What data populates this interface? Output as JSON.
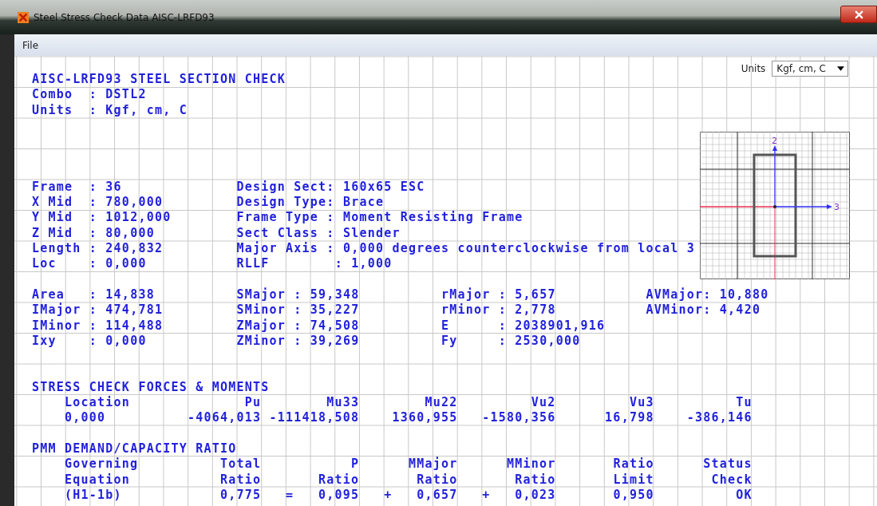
{
  "window": {
    "title": "Steel Stress Check Data  AISC-LRFD93"
  },
  "menu": [
    {
      "label": "File"
    }
  ],
  "units_selector": {
    "label": "Units",
    "value": "Kgf, cm, C"
  },
  "report": {
    "heading": "AISC-LRFD93 STEEL SECTION CHECK",
    "header_lines": [
      "Combo  : DSTL2",
      "Units  : Kgf, cm, C"
    ],
    "frame_block": [
      [
        "Frame  : 36",
        "Design Sect: 160x65 ESC"
      ],
      [
        "X Mid  : 780,000",
        "Design Type: Brace"
      ],
      [
        "Y Mid  : 1012,000",
        "Frame Type : Moment Resisting Frame"
      ],
      [
        "Z Mid  : 80,000",
        "Sect Class : Slender"
      ],
      [
        "Length : 240,832",
        "Major Axis : 0,000 degrees counterclockwise from local 3"
      ],
      [
        "Loc    : 0,000",
        "RLLF        : 1,000"
      ]
    ],
    "section_block": [
      [
        "Area   : 14,838",
        "SMajor : 59,348",
        "rMajor : 5,657",
        "AVMajor: 10,880"
      ],
      [
        "IMajor : 474,781",
        "SMinor : 35,227",
        "rMinor : 2,778",
        "AVMinor: 4,420"
      ],
      [
        "IMinor : 114,488",
        "ZMajor : 74,508",
        "E      : 2038901,916"
      ],
      [
        "Ixy    : 0,000",
        "ZMinor : 39,269",
        "Fy     : 2530,000"
      ]
    ],
    "forces": {
      "heading": "STRESS CHECK FORCES & MOMENTS",
      "columns": [
        {
          "header": [
            "Location"
          ],
          "value": "0,000"
        },
        {
          "header": [
            "Pu"
          ],
          "value": "-4064,013"
        },
        {
          "header": [
            "Mu33"
          ],
          "value": "-111418,508"
        },
        {
          "header": [
            "Mu22"
          ],
          "value": "1360,955"
        },
        {
          "header": [
            "Vu2"
          ],
          "value": "-1580,356"
        },
        {
          "header": [
            "Vu3"
          ],
          "value": "16,798"
        },
        {
          "header": [
            "Tu"
          ],
          "value": "-386,146"
        }
      ]
    },
    "pmm": {
      "heading": "PMM DEMAND/CAPACITY RATIO",
      "columns": [
        {
          "header": [
            "Governing",
            "Equation"
          ],
          "value": "(H1-1b)"
        },
        {
          "header": [
            "Total",
            "Ratio"
          ],
          "value": "0,775"
        },
        {
          "header": [
            "P",
            "Ratio"
          ],
          "value": "0,095",
          "operator": "="
        },
        {
          "header": [
            "MMajor",
            "Ratio"
          ],
          "value": "0,657",
          "operator": "+"
        },
        {
          "header": [
            "MMinor",
            "Ratio"
          ],
          "value": "0,023",
          "operator": "+"
        },
        {
          "header": [
            "Ratio",
            "Limit"
          ],
          "value": "0,950"
        },
        {
          "header": [
            "Status",
            "Check"
          ],
          "value": "OK"
        }
      ]
    }
  },
  "section_drawing": {
    "axis_labels": [
      "2",
      "3"
    ]
  }
}
